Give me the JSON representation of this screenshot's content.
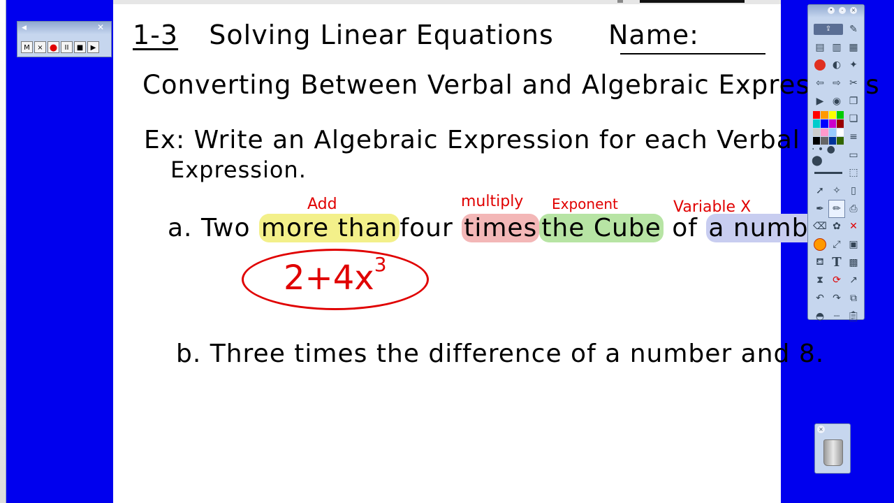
{
  "whiteboard": {
    "title_num": "1-3",
    "title": "Solving Linear Equations",
    "name_label": "Name:",
    "subtitle": "Converting Between Verbal and Algebraic Expressions",
    "example_line1": "Ex: Write an Algebraic Expression for each Verbal",
    "example_line2": "Expression.",
    "problem_a": {
      "letter": "a.",
      "w1": "Two",
      "w2": "more than",
      "w3": "four",
      "w4": "times",
      "w5": "the Cube",
      "w6": "of",
      "w7": "a number"
    },
    "labels": {
      "add": "Add",
      "multiply": "multiply",
      "exponent": "Exponent",
      "variable": "Variable X"
    },
    "answer": {
      "base": "2+4x",
      "exponent": "3"
    },
    "problem_b": "b. Three times the difference of a number and 8."
  },
  "recorder": {
    "buttons": [
      "M",
      "×",
      "●",
      "II",
      "■",
      "▶"
    ]
  },
  "colors": {
    "background": "#0000ee",
    "ink": "#000000",
    "red_ink": "#e00000",
    "highlight_yellow": "#f3f08a",
    "highlight_red": "#f3b7b7",
    "highlight_green": "#b7e4a4",
    "highlight_blue": "#c8cdf0"
  },
  "toolbar": {
    "icons": [
      "screen-capture-icon",
      "",
      "pen-settings-icon",
      "page-sorter-icon",
      "",
      "properties-icon",
      "stop-icon",
      "",
      "gallery-icon",
      "previous-page-icon",
      "",
      "next-page-icon",
      "play-icon",
      "",
      "record-icon",
      "",
      "",
      "cut-icon",
      "color-palette-icon",
      "",
      "copy-icon",
      "",
      "",
      "paste-icon",
      "",
      "",
      "line-style-icon",
      "line-width-slider-icon",
      "",
      "fill-icon",
      "select-icon",
      "",
      "magic-wand-icon",
      "pen-icon",
      "",
      "highlighter-icon",
      "eraser-icon",
      "",
      "print-icon",
      "shape-icon",
      "",
      "delete-icon",
      "fill-color-icon",
      "",
      "insert-icon",
      "paint-bucket-icon",
      "",
      "text-icon",
      "save-icon",
      "",
      "clear-icon",
      "undo-icon",
      "",
      "redo-icon",
      "protractor-icon",
      "",
      "clipboard-icon"
    ]
  }
}
